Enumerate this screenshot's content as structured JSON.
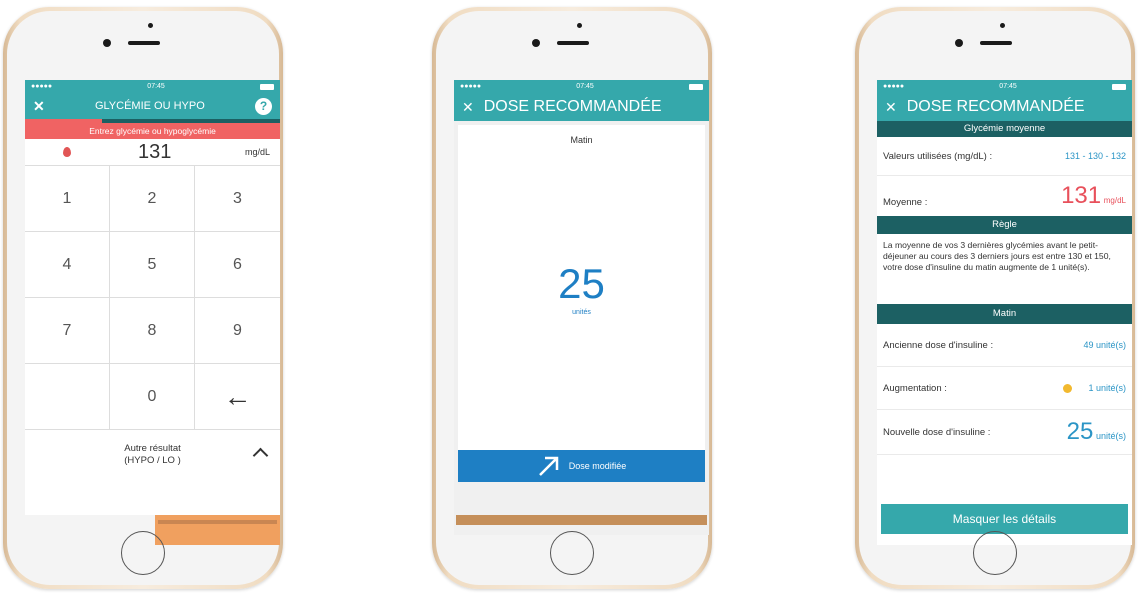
{
  "phone1": {
    "status_time": "07:45",
    "signal": "●●●●● ",
    "title": "GLYCÉMIE OU HYPO",
    "help_icon": "?",
    "close_icon": "✕",
    "banner": "Entrez glycémie ou hypoglycémie",
    "value": "131",
    "unit": "mg/dL",
    "keys": [
      "1",
      "2",
      "3",
      "4",
      "5",
      "6",
      "7",
      "8",
      "9",
      "",
      "0",
      "←"
    ],
    "alt_label_line1": "Autre résultat",
    "alt_label_line2": "(HYPO / LO )",
    "alt_chevron": "^",
    "colors": {
      "accent": "#35a8ab",
      "banner": "#f06363",
      "drop": "#e15555",
      "orange": "#f0a05f"
    }
  },
  "phone2": {
    "status_time": "07:45",
    "signal": "●●●●● ",
    "close_icon": "✕",
    "title": "DOSE RECOMMANDÉE",
    "period": "Matin",
    "dose": "25",
    "dose_unit": "unités",
    "button_label": "Dose modifiée",
    "colors": {
      "button": "#1e7fc4",
      "dose": "#1e7fc4",
      "orange": "#c58f5a"
    }
  },
  "phone3": {
    "status_time": "07:45",
    "signal": "●●●●● ",
    "close_icon": "✕",
    "title": "DOSE RECOMMANDÉE",
    "section1": "Glycémie moyenne",
    "values_label": "Valeurs utilisées (mg/dL) :",
    "values": "131 - 130 - 132",
    "mean_label": "Moyenne :",
    "mean_value": "131",
    "mean_unit": "mg/dL",
    "section2": "Règle",
    "rule_text": "La moyenne de vos 3 dernières glycémies avant le petit-déjeuner au cours des 3 derniers jours est entre 130 et 150, votre dose d'insuline du matin augmente de 1 unité(s).",
    "section3": "Matin",
    "old_dose_label": "Ancienne dose d'insuline :",
    "old_dose_value": "49 unité(s)",
    "increase_label": "Augmentation :",
    "increase_value": "1 unité(s)",
    "new_dose_label": "Nouvelle dose d'insuline :",
    "new_dose_value": "25",
    "new_dose_unit": "unité(s)",
    "hide_button": "Masquer les détails",
    "colors": {
      "teal": "#35a8ab",
      "dark": "#1c6063",
      "red": "#e8505b",
      "blue": "#2b95c6",
      "yellow": "#f2b92f"
    }
  }
}
